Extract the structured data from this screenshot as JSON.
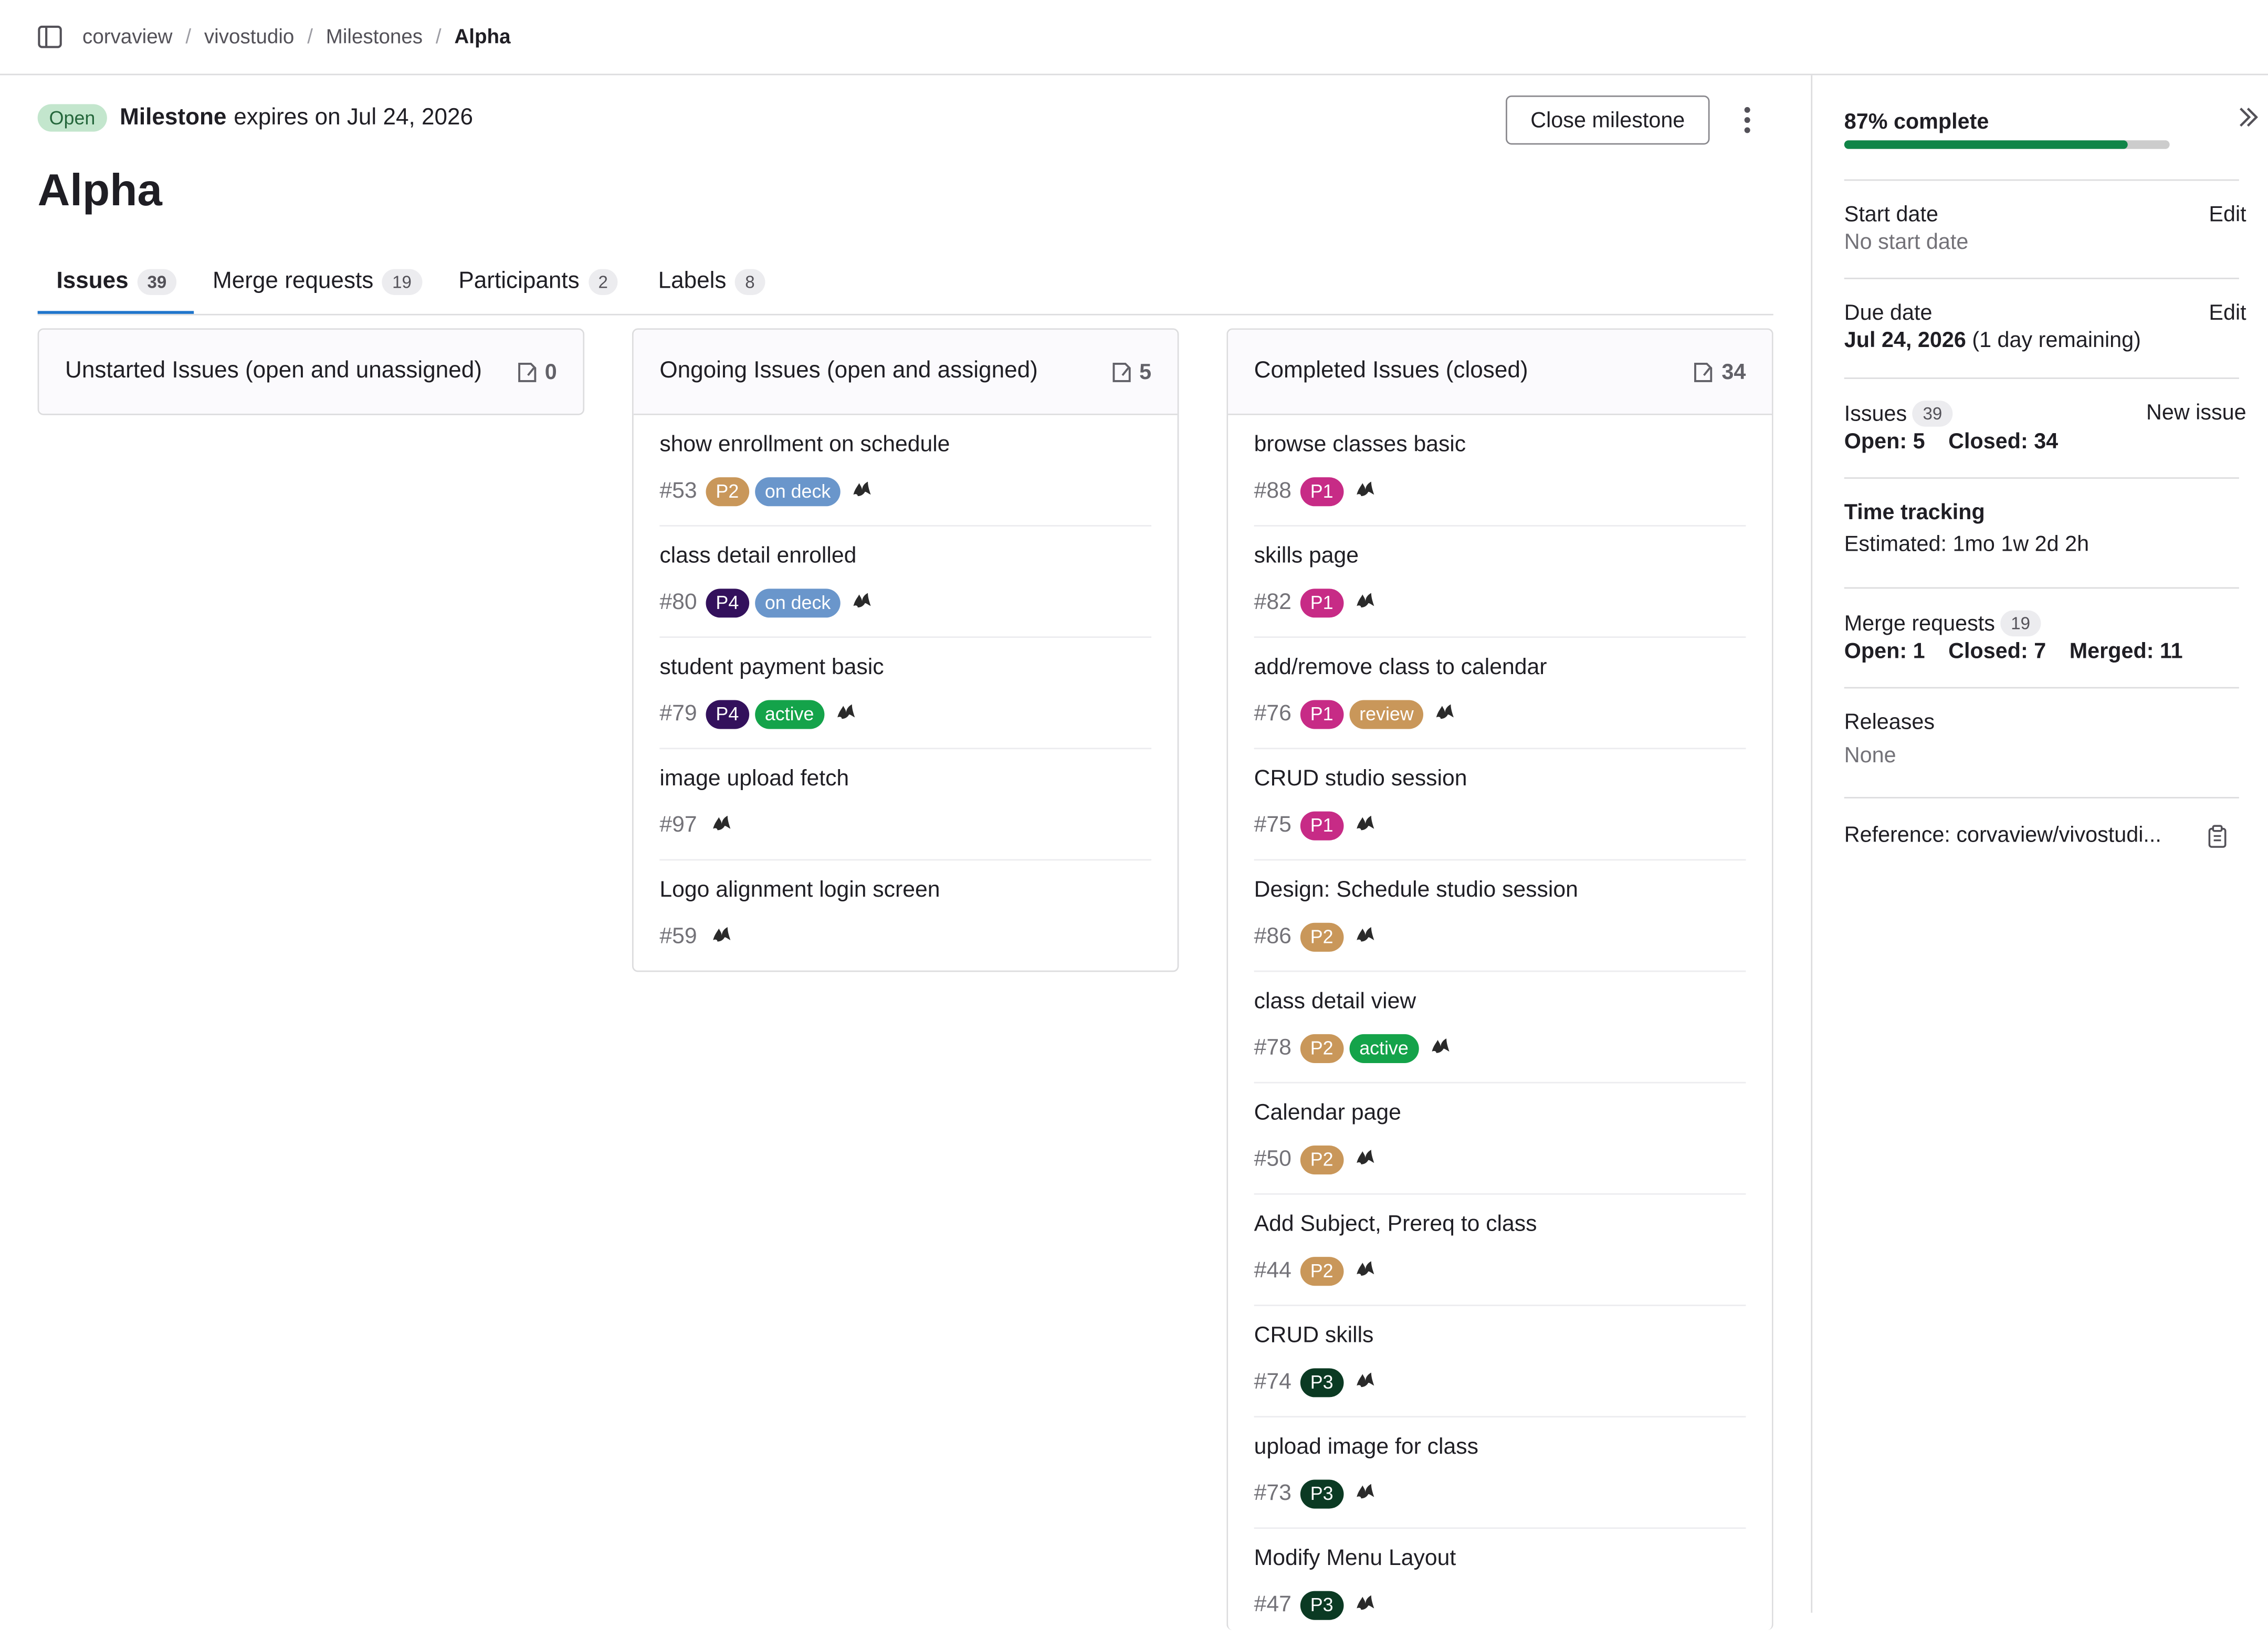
{
  "breadcrumb": [
    "corvaview",
    "vivostudio",
    "Milestones",
    "Alpha"
  ],
  "header": {
    "state_badge": "Open",
    "milestone_word": "Milestone",
    "expires_text": "expires on Jul 24, 2026",
    "close_button": "Close milestone",
    "title": "Alpha"
  },
  "tabs": [
    {
      "label": "Issues",
      "count": "39",
      "active": true
    },
    {
      "label": "Merge requests",
      "count": "19"
    },
    {
      "label": "Participants",
      "count": "2"
    },
    {
      "label": "Labels",
      "count": "8"
    }
  ],
  "label_colors": {
    "P1": "#c72b86",
    "P2": "#c9975a",
    "P3": "#0b3a23",
    "P4": "#33115c",
    "on deck": "#6a96cb",
    "active": "#14a34a",
    "review": "#c9975a"
  },
  "columns": [
    {
      "title": "Unstarted Issues (open and unassigned)",
      "count": "0",
      "issues": []
    },
    {
      "title": "Ongoing Issues (open and assigned)",
      "count": "5",
      "issues": [
        {
          "title": "show enrollment on schedule",
          "ref": "#53",
          "labels": [
            "P2",
            "on deck"
          ]
        },
        {
          "title": "class detail enrolled",
          "ref": "#80",
          "labels": [
            "P4",
            "on deck"
          ]
        },
        {
          "title": "student payment basic",
          "ref": "#79",
          "labels": [
            "P4",
            "active"
          ]
        },
        {
          "title": "image upload fetch",
          "ref": "#97",
          "labels": []
        },
        {
          "title": "Logo alignment login screen",
          "ref": "#59",
          "labels": []
        }
      ]
    },
    {
      "title": "Completed Issues (closed)",
      "count": "34",
      "issues": [
        {
          "title": "browse classes basic",
          "ref": "#88",
          "labels": [
            "P1"
          ]
        },
        {
          "title": "skills page",
          "ref": "#82",
          "labels": [
            "P1"
          ]
        },
        {
          "title": "add/remove class to calendar",
          "ref": "#76",
          "labels": [
            "P1",
            "review"
          ]
        },
        {
          "title": "CRUD studio session",
          "ref": "#75",
          "labels": [
            "P1"
          ]
        },
        {
          "title": "Design: Schedule studio session",
          "ref": "#86",
          "labels": [
            "P2"
          ]
        },
        {
          "title": "class detail view",
          "ref": "#78",
          "labels": [
            "P2",
            "active"
          ]
        },
        {
          "title": "Calendar page",
          "ref": "#50",
          "labels": [
            "P2"
          ]
        },
        {
          "title": "Add Subject, Prereq to class",
          "ref": "#44",
          "labels": [
            "P2"
          ]
        },
        {
          "title": "CRUD skills",
          "ref": "#74",
          "labels": [
            "P3"
          ]
        },
        {
          "title": "upload image for class",
          "ref": "#73",
          "labels": [
            "P3"
          ]
        },
        {
          "title": "Modify Menu Layout",
          "ref": "#47",
          "labels": [
            "P3"
          ]
        }
      ]
    }
  ],
  "sidebar": {
    "progress_text": "87% complete",
    "progress_value": 0.87,
    "start_date_label": "Start date",
    "start_date_value": "No start date",
    "due_date_label": "Due date",
    "due_date_value": "Jul 24, 2026",
    "due_date_remaining": "(1 day remaining)",
    "edit_label": "Edit",
    "issues_label": "Issues",
    "issues_count": "39",
    "new_issue": "New issue",
    "issues_open": "Open: 5",
    "issues_closed": "Closed: 34",
    "time_tracking_label": "Time tracking",
    "time_estimated": "Estimated: 1mo 1w 2d 2h",
    "mr_label": "Merge requests",
    "mr_count": "19",
    "mr_open": "Open: 1",
    "mr_closed": "Closed: 7",
    "mr_merged": "Merged: 11",
    "releases_label": "Releases",
    "releases_value": "None",
    "reference": "Reference: corvaview/vivostudi..."
  }
}
